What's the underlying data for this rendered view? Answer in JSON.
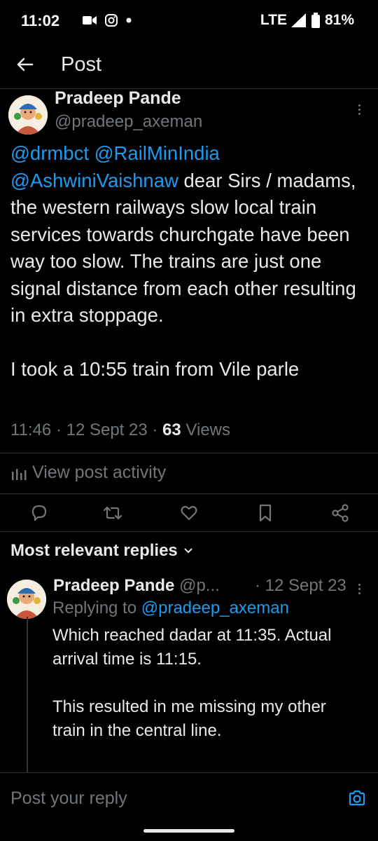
{
  "status_bar": {
    "time": "11:02",
    "network": "LTE",
    "battery": "81%"
  },
  "app_bar": {
    "title": "Post",
    "back_icon": "arrow-left-icon"
  },
  "post": {
    "author_name": "Pradeep Pande",
    "author_handle": "@pradeep_axeman",
    "mention1": "@drmbct",
    "mention2": "@RailMinIndia",
    "mention3": "@AshwiniVaishnaw",
    "body": " dear Sirs / madams, the western railways slow local train services towards churchgate have been way too slow. The trains are just one signal distance from each other resulting in extra stoppage.\n\nI took a 10:55 train from Vile parle",
    "time": "11:46",
    "date": "12 Sept 23",
    "views_count": "63",
    "views_label": "Views",
    "activity_label": "View post activity"
  },
  "actions": {
    "reply_icon": "reply-icon",
    "repost_icon": "repost-icon",
    "like_icon": "heart-icon",
    "bookmark_icon": "bookmark-icon",
    "share_icon": "share-icon"
  },
  "replies": {
    "header": "Most relevant replies",
    "items": [
      {
        "author_name": "Pradeep Pande",
        "author_handle": "@p...",
        "date": "· 12 Sept 23",
        "replying_label": "Replying to",
        "replying_handle": "@pradeep_axeman",
        "text": "Which reached dadar at 11:35. Actual arrival time is 11:15.\n\nThis resulted in me missing my other train in the central line."
      }
    ]
  },
  "composer": {
    "placeholder": "Post your reply"
  },
  "colors": {
    "background": "#000000",
    "text": "#e7e9ea",
    "secondary": "#71767b",
    "accent": "#1d9bf0",
    "divider": "#2f3336"
  }
}
